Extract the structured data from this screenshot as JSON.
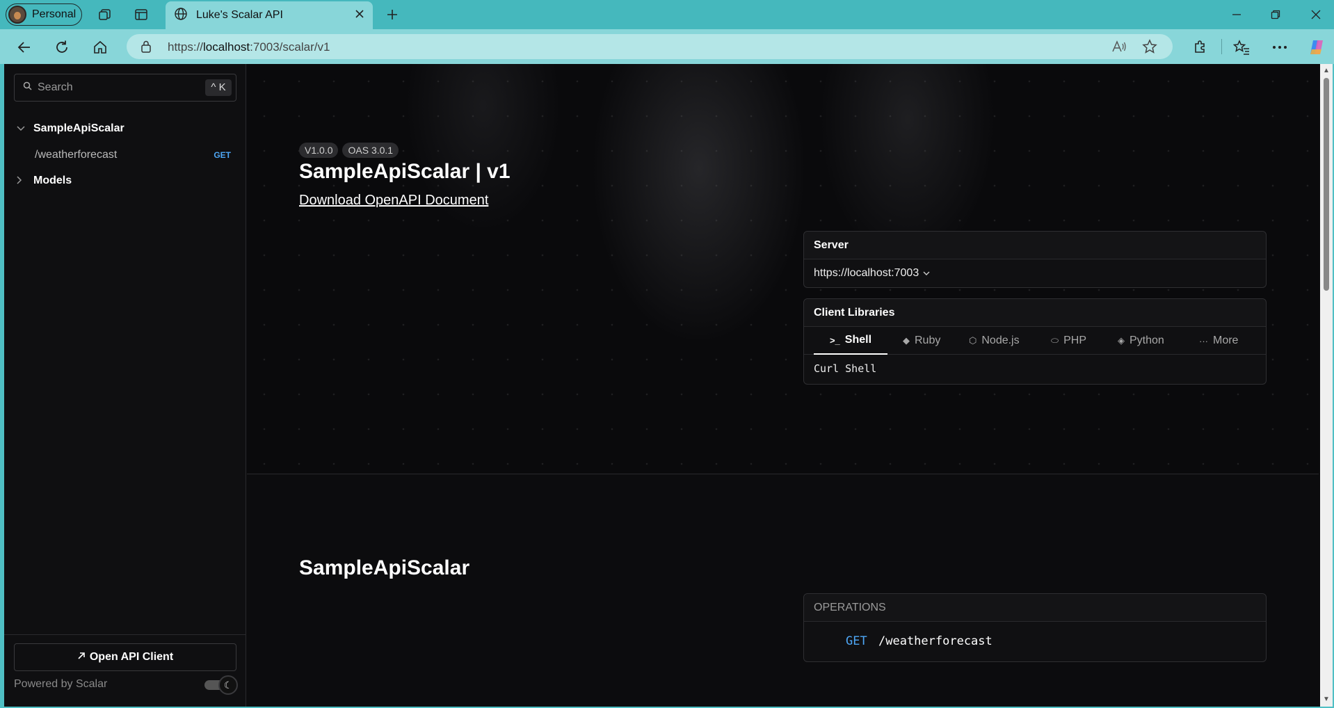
{
  "browser": {
    "profile_label": "Personal",
    "tab_title": "Luke's Scalar API",
    "url_prefix": "https://",
    "url_host": "localhost",
    "url_path": ":7003/scalar/v1"
  },
  "sidebar": {
    "search_placeholder": "Search",
    "search_shortcut": "^ K",
    "groups": [
      {
        "label": "SampleApiScalar",
        "expanded": true
      },
      {
        "label": "Models",
        "expanded": false
      }
    ],
    "endpoint": {
      "path": "/weatherforecast",
      "method": "GET"
    },
    "open_client_label": "Open API Client",
    "powered_by": "Powered by Scalar"
  },
  "hero": {
    "version_badge": "V1.0.0",
    "oas_badge": "OAS 3.0.1",
    "title": "SampleApiScalar | v1",
    "download_link": "Download OpenAPI Document"
  },
  "server": {
    "heading": "Server",
    "url": "https://localhost:7003"
  },
  "client_libraries": {
    "heading": "Client Libraries",
    "tabs": [
      "Shell",
      "Ruby",
      "Node.js",
      "PHP",
      "Python",
      "More"
    ],
    "active_tab": "Shell",
    "selected_client": "Curl Shell"
  },
  "section": {
    "title": "SampleApiScalar",
    "operations_heading": "OPERATIONS",
    "operations": [
      {
        "method": "GET",
        "path": "/weatherforecast"
      }
    ]
  },
  "colors": {
    "browser_frame": "#45b8bd",
    "toolbar": "#88d6d9",
    "page_bg": "#0c0c0e",
    "get_method": "#4ea7f6"
  }
}
